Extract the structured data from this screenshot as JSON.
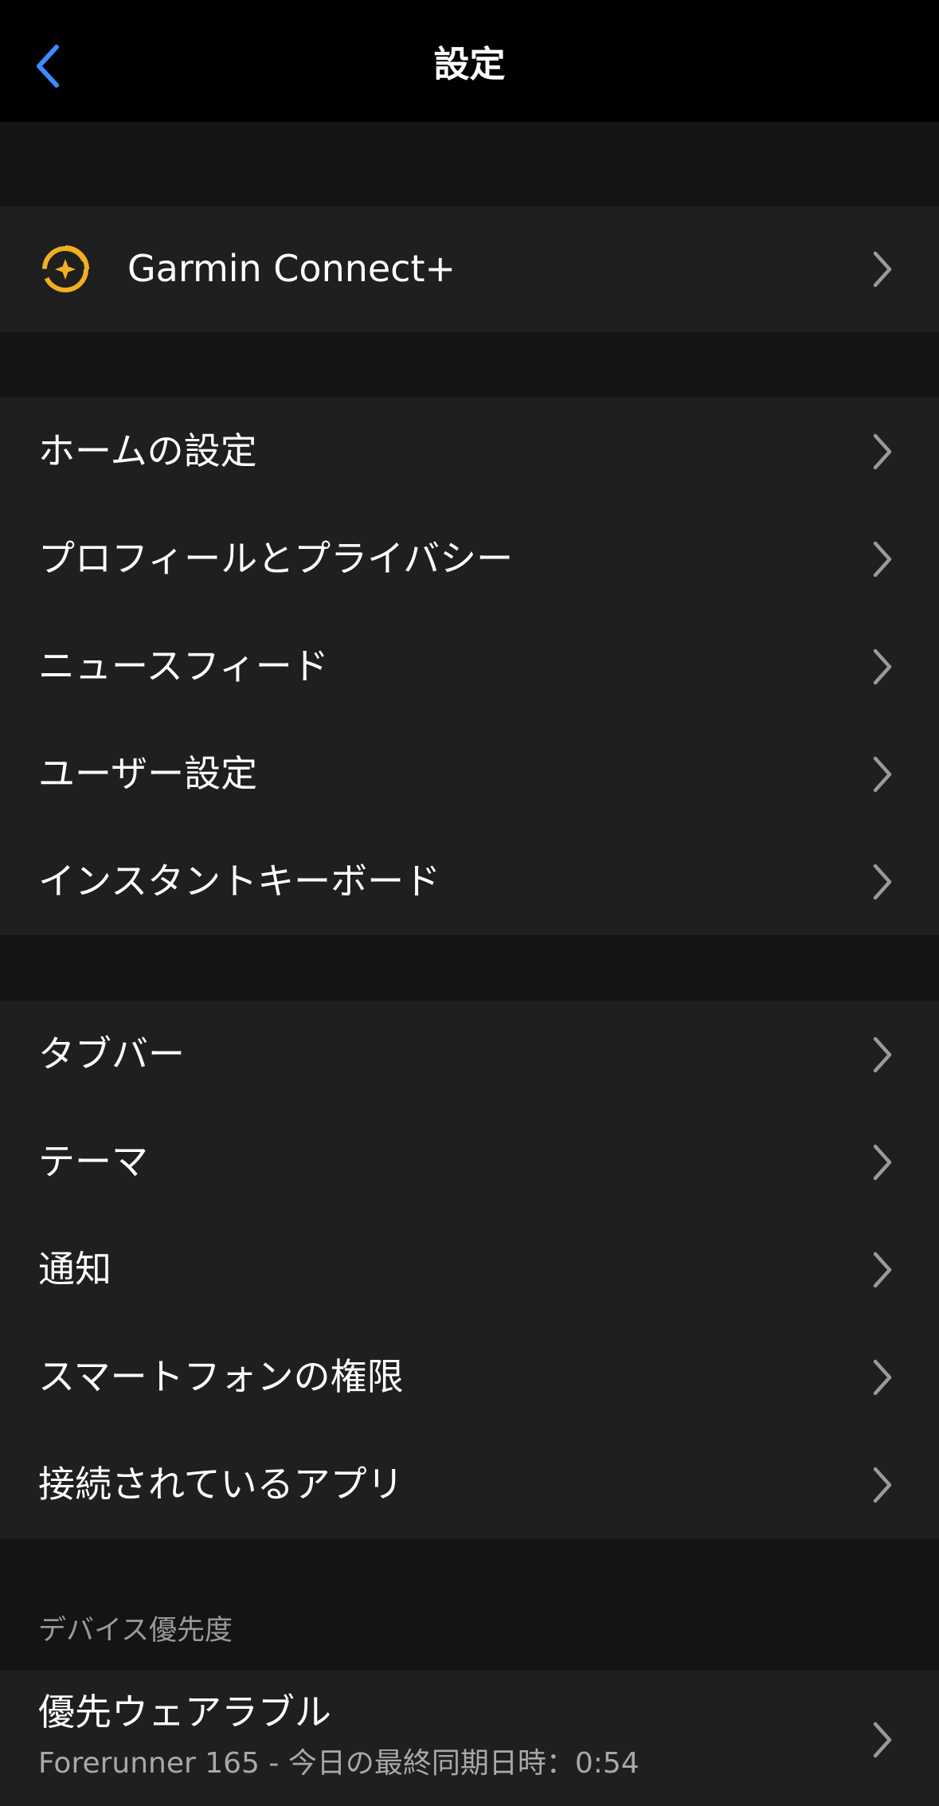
{
  "navbar": {
    "title": "設定",
    "back_icon": "chevron-left-icon",
    "accent_color": "#3d8bfd"
  },
  "garmin_connect_plus": {
    "label": "Garmin Connect+",
    "icon": "garmin-connect-plus-icon",
    "icon_color": "#f0b020"
  },
  "group1": {
    "items": [
      {
        "label": "ホームの設定"
      },
      {
        "label": "プロフィールとプライバシー"
      },
      {
        "label": "ニュースフィード"
      },
      {
        "label": "ユーザー設定"
      },
      {
        "label": "インスタントキーボード"
      }
    ]
  },
  "group2": {
    "items": [
      {
        "label": "タブバー"
      },
      {
        "label": "テーマ"
      },
      {
        "label": "通知"
      },
      {
        "label": "スマートフォンの権限"
      },
      {
        "label": "接続されているアプリ"
      }
    ]
  },
  "device_priority": {
    "header": "デバイス優先度",
    "preferred_wearable": {
      "title": "優先ウェアラブル",
      "subtitle": "Forerunner 165 - 今日の最終同期日時：0:54"
    }
  }
}
